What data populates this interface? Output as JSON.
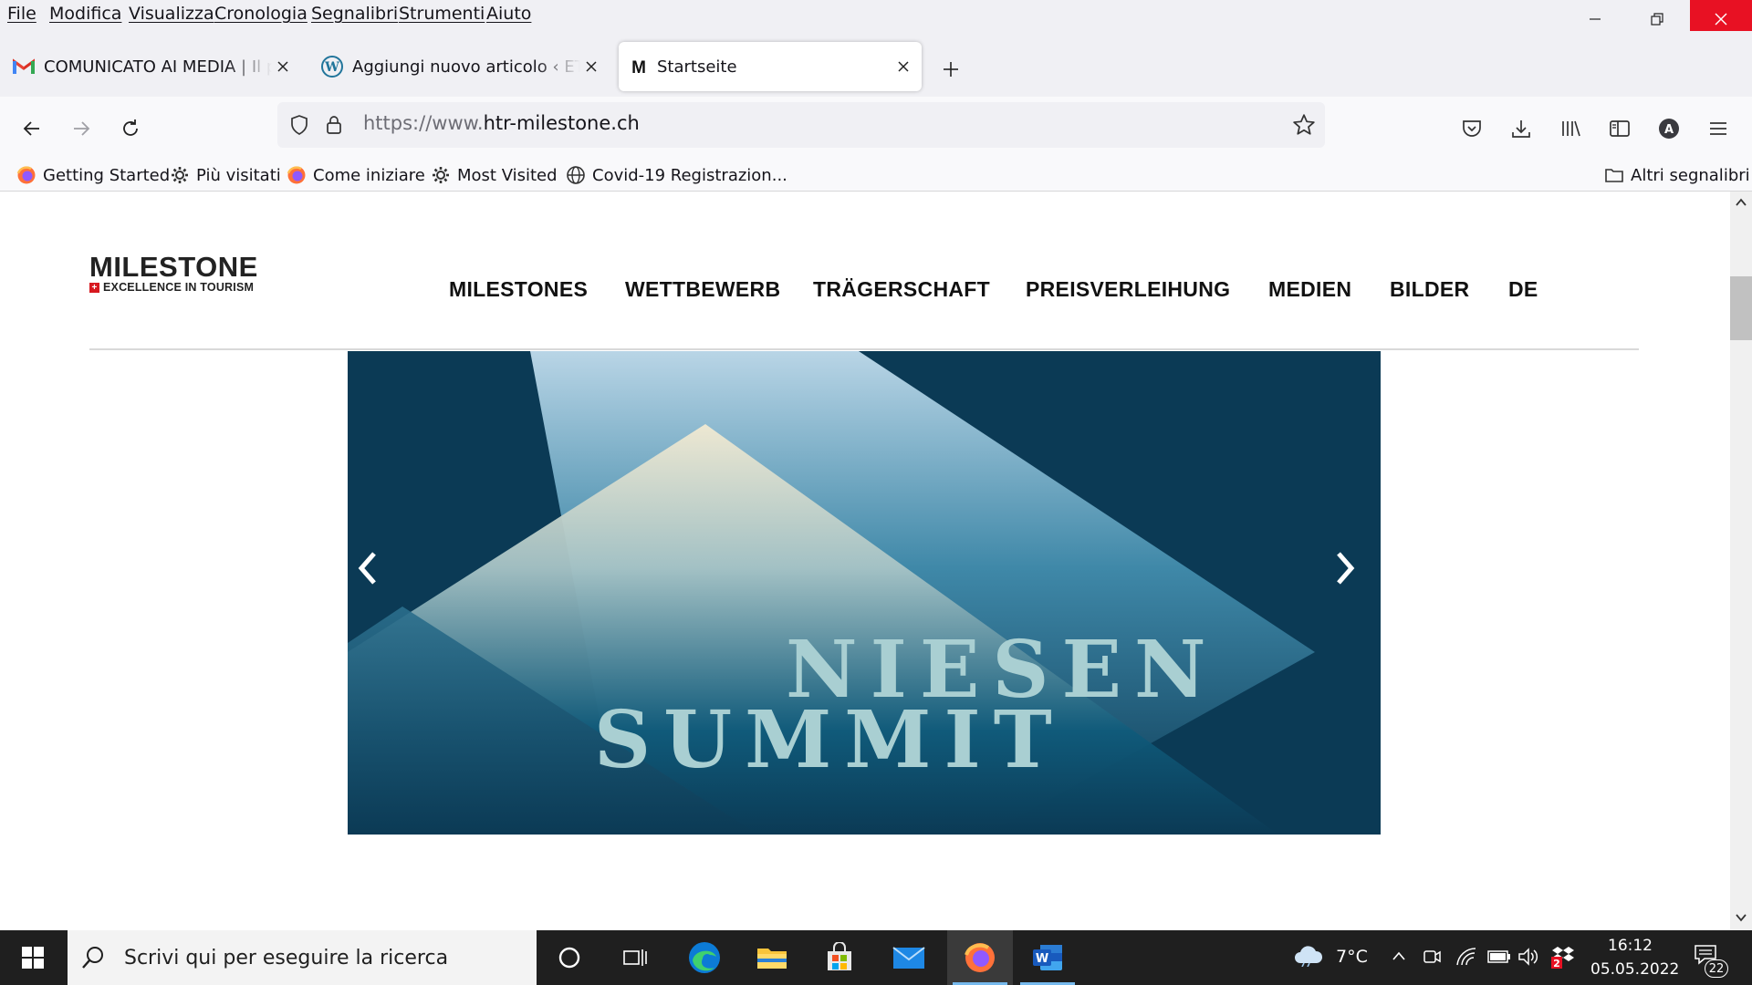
{
  "menubar": {
    "items": [
      "File",
      "Modifica",
      "Visualizza",
      "Cronologia",
      "Segnalibri",
      "Strumenti",
      "Aiuto"
    ]
  },
  "tabs": [
    {
      "title": "COMUNICATO AI MEDIA | Il premio",
      "icon": "gmail-icon",
      "active": false
    },
    {
      "title": "Aggiungi nuovo articolo ‹ ETiCinema",
      "icon": "wordpress-icon",
      "active": false
    },
    {
      "title": "Startseite",
      "icon": "milestone-m-icon",
      "active": true
    }
  ],
  "urlbar": {
    "prefix": "https://www.",
    "domain": "htr-milestone.ch"
  },
  "bookmarks": {
    "items": [
      {
        "label": "Getting Started",
        "icon": "firefox-icon"
      },
      {
        "label": "Più visitati",
        "icon": "gear-icon"
      },
      {
        "label": "Come iniziare",
        "icon": "firefox-icon"
      },
      {
        "label": "Most Visited",
        "icon": "gear-icon"
      },
      {
        "label": "Covid-19 Registrazion...",
        "icon": "globe-icon"
      }
    ],
    "other": "Altri segnalibri"
  },
  "site": {
    "logo_main": "MILESTONE",
    "logo_sub": "EXCELLENCE IN TOURISM",
    "nav": [
      "MILESTONES",
      "WETTBEWERB",
      "TRÄGERSCHAFT",
      "PREISVERLEIHUNG",
      "MEDIEN",
      "BILDER",
      "DE"
    ],
    "hero_line1": "NIESEN",
    "hero_line2": "SUMMIT"
  },
  "taskbar": {
    "search_placeholder": "Scrivi qui per eseguire la ricerca",
    "weather": "7°C",
    "time": "16:12",
    "date": "05.05.2022",
    "notification_count": "22",
    "dropbox_badge": "2"
  },
  "colors": {
    "chrome_bg": "#f0f0f4",
    "toolbar_bg": "#f9f9fb",
    "close_red": "#e81123",
    "hero_dark": "#0b3a55",
    "hero_text": "#a9cfd2",
    "taskbar_bg": "#1f1f1f"
  }
}
